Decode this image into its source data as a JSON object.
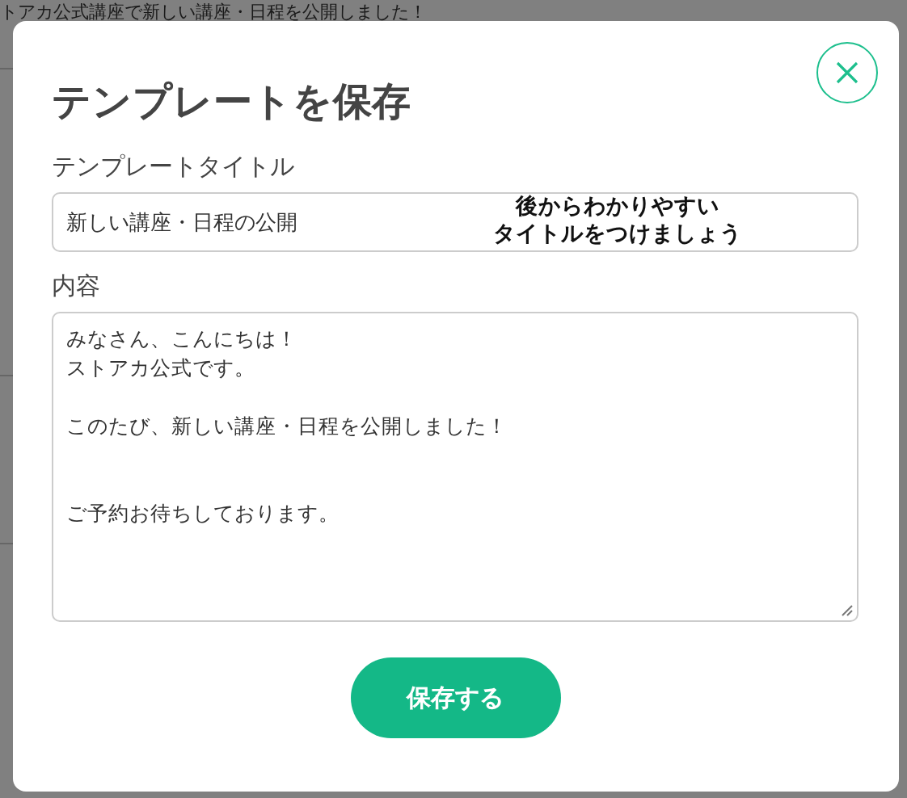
{
  "background": {
    "text": "トアカ公式講座で新しい講座・日程を公開しました！"
  },
  "dialog": {
    "title": "テンプレートを保存",
    "title_field": {
      "label": "テンプレートタイトル",
      "value": "新しい講座・日程の公開",
      "annotation": [
        "後からわかりやすい",
        "タイトルをつけましょう"
      ]
    },
    "content_field": {
      "label": "内容",
      "lines": [
        {
          "kind": "text",
          "text": "みなさん、こんにちは！"
        },
        {
          "kind": "text",
          "text": "ストアカ公式です。"
        },
        {
          "kind": "blank"
        },
        {
          "kind": "text",
          "text": "このたび、新しい講座・日程を公開しました！"
        },
        {
          "kind": "blank"
        },
        {
          "kind": "blank"
        },
        {
          "kind": "text",
          "text": "ご予約お待ちしております。"
        }
      ]
    },
    "save_button": "保存する"
  }
}
